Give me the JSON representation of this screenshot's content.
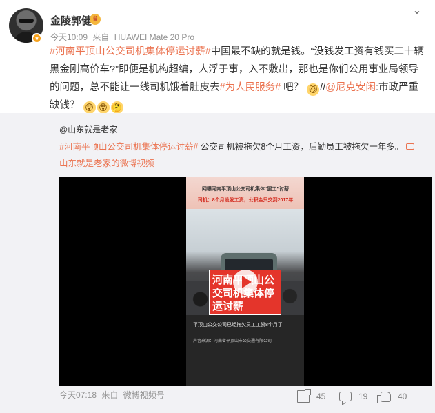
{
  "post": {
    "username": "金陵郭健",
    "verified_badge": "v",
    "time": "今天10:09",
    "source_prefix": "来自",
    "device": "HUAWEI Mate 20 Pro",
    "text": {
      "topic1": "#河南平顶山公交司机集体停运讨薪#",
      "part1": "中国最不缺的就是钱。“没钱发工资有钱买二十辆黑金刚高价车?”即便是机构超编，人浮于事，入不敷出，那也是你们公用事业局领导的问题，总不能让一线司机饿着肚皮去",
      "topic2": "#为人民服务#",
      "part2": " 吧？",
      "emoji1": "😼",
      "slashes": "//",
      "mention": "@尼克安闲",
      "part3": ":市政严重缺钱？",
      "emoji2": "😲",
      "emoji3": "😵",
      "emoji4": "🤔"
    }
  },
  "forwarded": {
    "username": "@山东就是老家",
    "topic": "#河南平顶山公交司机集体停运讨薪#",
    "text": " 公交司机被拖欠8个月工资，后勤员工被拖欠一年多。",
    "link": "山东就是老家的微博视频",
    "video": {
      "thumb_title": "网曝河南平顶山公交司机集体“罢工”讨薪",
      "thumb_subtitle": "司机：8个月没发工资，公积金只交到2017年",
      "banner_text": "河南平顶山公交司机集体停运讨薪",
      "caption": "平顶山公交公司已经拖欠员工工资8个月了",
      "source": "声音来源：河南省平顶山市公交通有限公司"
    },
    "time": "今天07:18",
    "source_prefix": "来自",
    "source": "微博视频号",
    "actions": {
      "share_count": "45",
      "comment_count": "19",
      "like_count": "40"
    }
  },
  "colors": {
    "accent": "#eb7350",
    "meta": "#939393",
    "forward_bg": "#f2f2f5"
  },
  "icons": [
    "chevron-down-icon",
    "share-icon",
    "comment-icon",
    "like-icon",
    "link-icon",
    "play-icon"
  ]
}
